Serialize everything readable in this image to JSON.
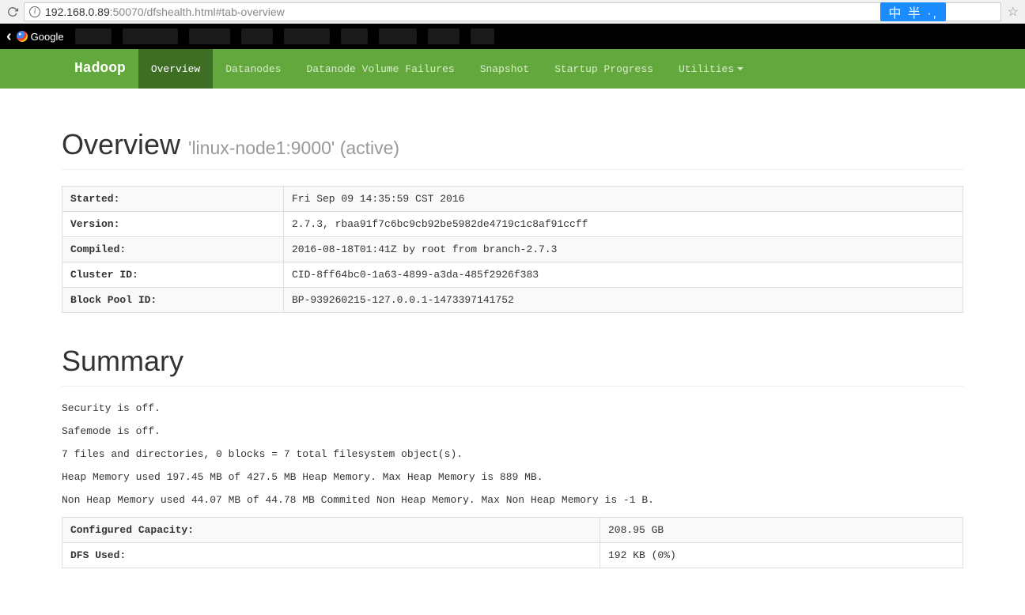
{
  "browser": {
    "url_host": "192.168.0.89",
    "url_rest": ":50070/dfshealth.html#tab-overview",
    "ime": "中 半 ·,",
    "bookmark_google": "Google"
  },
  "nav": {
    "brand": "Hadoop",
    "items": [
      "Overview",
      "Datanodes",
      "Datanode Volume Failures",
      "Snapshot",
      "Startup Progress",
      "Utilities"
    ]
  },
  "overview": {
    "title": "Overview",
    "subtitle": "'linux-node1:9000' (active)",
    "rows": [
      {
        "label": "Started:",
        "value": "Fri Sep 09 14:35:59 CST 2016"
      },
      {
        "label": "Version:",
        "value": "2.7.3, rbaa91f7c6bc9cb92be5982de4719c1c8af91ccff"
      },
      {
        "label": "Compiled:",
        "value": "2016-08-18T01:41Z by root from branch-2.7.3"
      },
      {
        "label": "Cluster ID:",
        "value": "CID-8ff64bc0-1a63-4899-a3da-485f2926f383"
      },
      {
        "label": "Block Pool ID:",
        "value": "BP-939260215-127.0.0.1-1473397141752"
      }
    ]
  },
  "summary": {
    "title": "Summary",
    "lines": [
      "Security is off.",
      "Safemode is off.",
      "7 files and directories, 0 blocks = 7 total filesystem object(s).",
      "Heap Memory used 197.45 MB of 427.5 MB Heap Memory. Max Heap Memory is 889 MB.",
      "Non Heap Memory used 44.07 MB of 44.78 MB Commited Non Heap Memory. Max Non Heap Memory is -1 B."
    ],
    "rows": [
      {
        "label": "Configured Capacity:",
        "value": "208.95 GB"
      },
      {
        "label": "DFS Used:",
        "value": "192 KB (0%)"
      }
    ]
  }
}
